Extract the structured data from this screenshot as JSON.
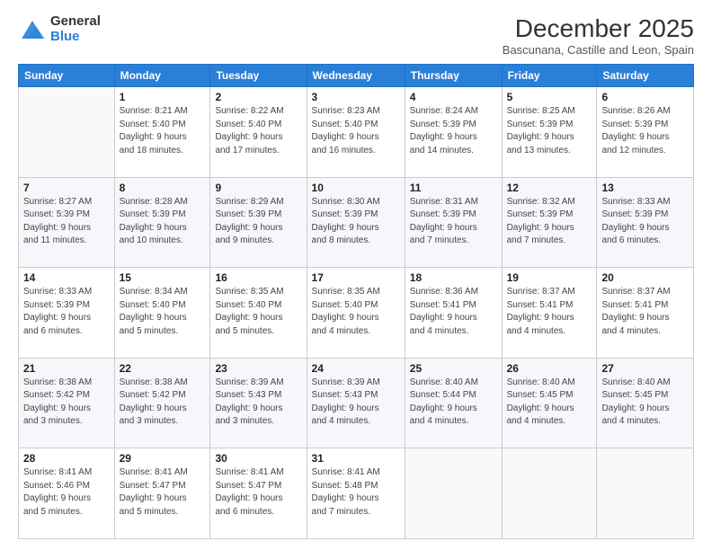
{
  "logo": {
    "general": "General",
    "blue": "Blue"
  },
  "header": {
    "month": "December 2025",
    "location": "Bascunana, Castille and Leon, Spain"
  },
  "days_of_week": [
    "Sunday",
    "Monday",
    "Tuesday",
    "Wednesday",
    "Thursday",
    "Friday",
    "Saturday"
  ],
  "weeks": [
    [
      {
        "day": "",
        "info": ""
      },
      {
        "day": "1",
        "info": "Sunrise: 8:21 AM\nSunset: 5:40 PM\nDaylight: 9 hours\nand 18 minutes."
      },
      {
        "day": "2",
        "info": "Sunrise: 8:22 AM\nSunset: 5:40 PM\nDaylight: 9 hours\nand 17 minutes."
      },
      {
        "day": "3",
        "info": "Sunrise: 8:23 AM\nSunset: 5:40 PM\nDaylight: 9 hours\nand 16 minutes."
      },
      {
        "day": "4",
        "info": "Sunrise: 8:24 AM\nSunset: 5:39 PM\nDaylight: 9 hours\nand 14 minutes."
      },
      {
        "day": "5",
        "info": "Sunrise: 8:25 AM\nSunset: 5:39 PM\nDaylight: 9 hours\nand 13 minutes."
      },
      {
        "day": "6",
        "info": "Sunrise: 8:26 AM\nSunset: 5:39 PM\nDaylight: 9 hours\nand 12 minutes."
      }
    ],
    [
      {
        "day": "7",
        "info": "Sunrise: 8:27 AM\nSunset: 5:39 PM\nDaylight: 9 hours\nand 11 minutes."
      },
      {
        "day": "8",
        "info": "Sunrise: 8:28 AM\nSunset: 5:39 PM\nDaylight: 9 hours\nand 10 minutes."
      },
      {
        "day": "9",
        "info": "Sunrise: 8:29 AM\nSunset: 5:39 PM\nDaylight: 9 hours\nand 9 minutes."
      },
      {
        "day": "10",
        "info": "Sunrise: 8:30 AM\nSunset: 5:39 PM\nDaylight: 9 hours\nand 8 minutes."
      },
      {
        "day": "11",
        "info": "Sunrise: 8:31 AM\nSunset: 5:39 PM\nDaylight: 9 hours\nand 7 minutes."
      },
      {
        "day": "12",
        "info": "Sunrise: 8:32 AM\nSunset: 5:39 PM\nDaylight: 9 hours\nand 7 minutes."
      },
      {
        "day": "13",
        "info": "Sunrise: 8:33 AM\nSunset: 5:39 PM\nDaylight: 9 hours\nand 6 minutes."
      }
    ],
    [
      {
        "day": "14",
        "info": "Sunrise: 8:33 AM\nSunset: 5:39 PM\nDaylight: 9 hours\nand 6 minutes."
      },
      {
        "day": "15",
        "info": "Sunrise: 8:34 AM\nSunset: 5:40 PM\nDaylight: 9 hours\nand 5 minutes."
      },
      {
        "day": "16",
        "info": "Sunrise: 8:35 AM\nSunset: 5:40 PM\nDaylight: 9 hours\nand 5 minutes."
      },
      {
        "day": "17",
        "info": "Sunrise: 8:35 AM\nSunset: 5:40 PM\nDaylight: 9 hours\nand 4 minutes."
      },
      {
        "day": "18",
        "info": "Sunrise: 8:36 AM\nSunset: 5:41 PM\nDaylight: 9 hours\nand 4 minutes."
      },
      {
        "day": "19",
        "info": "Sunrise: 8:37 AM\nSunset: 5:41 PM\nDaylight: 9 hours\nand 4 minutes."
      },
      {
        "day": "20",
        "info": "Sunrise: 8:37 AM\nSunset: 5:41 PM\nDaylight: 9 hours\nand 4 minutes."
      }
    ],
    [
      {
        "day": "21",
        "info": "Sunrise: 8:38 AM\nSunset: 5:42 PM\nDaylight: 9 hours\nand 3 minutes."
      },
      {
        "day": "22",
        "info": "Sunrise: 8:38 AM\nSunset: 5:42 PM\nDaylight: 9 hours\nand 3 minutes."
      },
      {
        "day": "23",
        "info": "Sunrise: 8:39 AM\nSunset: 5:43 PM\nDaylight: 9 hours\nand 3 minutes."
      },
      {
        "day": "24",
        "info": "Sunrise: 8:39 AM\nSunset: 5:43 PM\nDaylight: 9 hours\nand 4 minutes."
      },
      {
        "day": "25",
        "info": "Sunrise: 8:40 AM\nSunset: 5:44 PM\nDaylight: 9 hours\nand 4 minutes."
      },
      {
        "day": "26",
        "info": "Sunrise: 8:40 AM\nSunset: 5:45 PM\nDaylight: 9 hours\nand 4 minutes."
      },
      {
        "day": "27",
        "info": "Sunrise: 8:40 AM\nSunset: 5:45 PM\nDaylight: 9 hours\nand 4 minutes."
      }
    ],
    [
      {
        "day": "28",
        "info": "Sunrise: 8:41 AM\nSunset: 5:46 PM\nDaylight: 9 hours\nand 5 minutes."
      },
      {
        "day": "29",
        "info": "Sunrise: 8:41 AM\nSunset: 5:47 PM\nDaylight: 9 hours\nand 5 minutes."
      },
      {
        "day": "30",
        "info": "Sunrise: 8:41 AM\nSunset: 5:47 PM\nDaylight: 9 hours\nand 6 minutes."
      },
      {
        "day": "31",
        "info": "Sunrise: 8:41 AM\nSunset: 5:48 PM\nDaylight: 9 hours\nand 7 minutes."
      },
      {
        "day": "",
        "info": ""
      },
      {
        "day": "",
        "info": ""
      },
      {
        "day": "",
        "info": ""
      }
    ]
  ]
}
